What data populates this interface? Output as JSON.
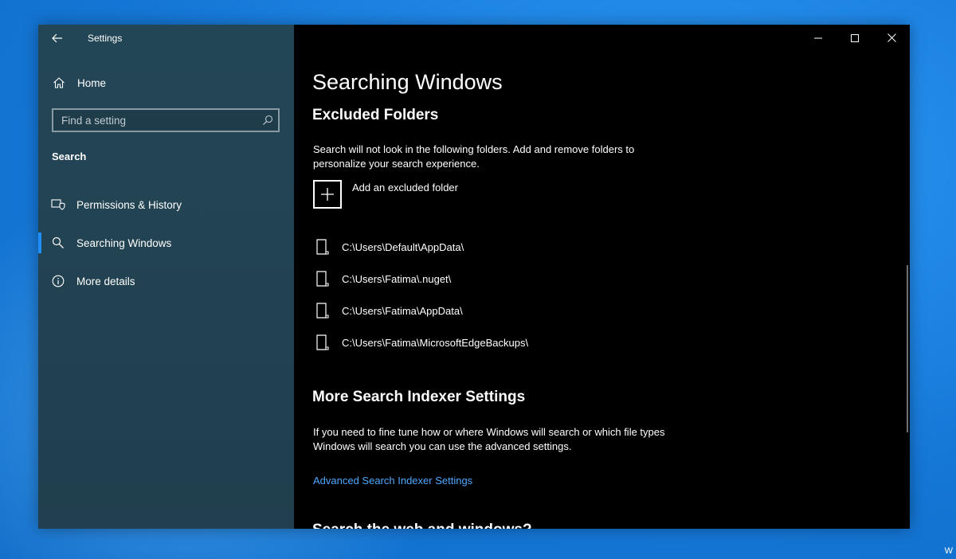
{
  "window": {
    "app_title": "Settings",
    "colors": {
      "sidebar": "#234656",
      "content": "#000000",
      "accent": "#1f8fff",
      "link": "#4ea8ff"
    }
  },
  "sidebar": {
    "home_label": "Home",
    "search_placeholder": "Find a setting",
    "section_title": "Search",
    "items": [
      {
        "label": "Permissions & History",
        "icon": "permissions-shield-icon",
        "active": false
      },
      {
        "label": "Searching Windows",
        "icon": "search-icon",
        "active": true
      },
      {
        "label": "More details",
        "icon": "info-icon",
        "active": false
      }
    ]
  },
  "main": {
    "page_title": "Searching Windows",
    "excluded": {
      "heading": "Excluded Folders",
      "description": "Search will not look in the following folders. Add and remove folders to personalize your search experience.",
      "add_label": "Add an excluded folder",
      "folders": [
        "C:\\Users\\Default\\AppData\\",
        "C:\\Users\\Fatima\\.nuget\\",
        "C:\\Users\\Fatima\\AppData\\",
        "C:\\Users\\Fatima\\MicrosoftEdgeBackups\\"
      ]
    },
    "indexer": {
      "heading": "More Search Indexer Settings",
      "description": "If you need to fine tune how or where Windows will search or which file types Windows will search you can use the advanced settings.",
      "link_label": "Advanced Search Indexer Settings"
    },
    "next_heading": "Search the web and windows?"
  },
  "desktop": {
    "corner_text": "W"
  }
}
